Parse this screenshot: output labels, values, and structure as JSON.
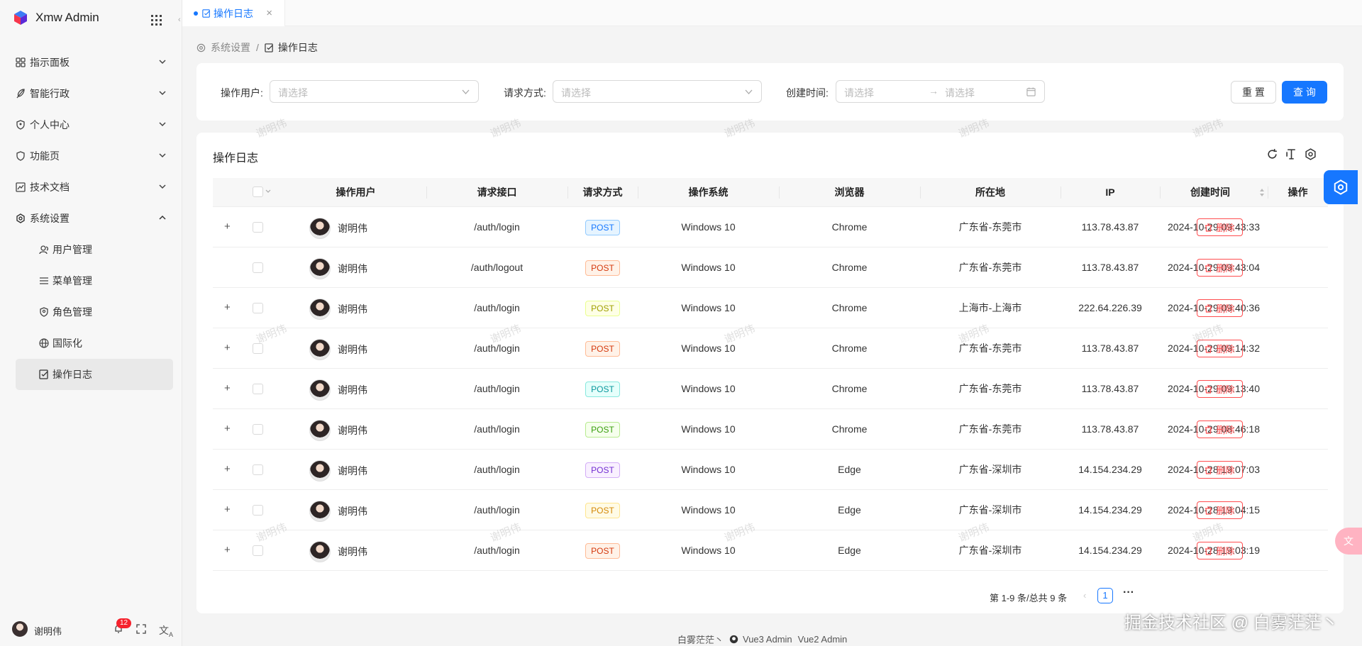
{
  "app": {
    "title": "Xmw Admin"
  },
  "sidebar": {
    "menu": [
      {
        "label": "指示面板",
        "icon": "dashboard-icon"
      },
      {
        "label": "智能行政",
        "icon": "feather-icon"
      },
      {
        "label": "个人中心",
        "icon": "user-shield-icon"
      },
      {
        "label": "功能页",
        "icon": "feature-icon"
      },
      {
        "label": "技术文档",
        "icon": "chart-doc-icon"
      },
      {
        "label": "系统设置",
        "icon": "settings-icon",
        "expanded": true
      }
    ],
    "submenu": [
      {
        "label": "用户管理",
        "icon": "users-icon"
      },
      {
        "label": "菜单管理",
        "icon": "menu-lines-icon"
      },
      {
        "label": "角色管理",
        "icon": "role-icon"
      },
      {
        "label": "国际化",
        "icon": "globe-icon"
      },
      {
        "label": "操作日志",
        "icon": "log-icon",
        "active": true
      }
    ],
    "user": {
      "name": "谢明伟",
      "notifications": "12"
    }
  },
  "tabs": [
    {
      "label": "操作日志"
    }
  ],
  "breadcrumb": {
    "parent": "系统设置",
    "current": "操作日志"
  },
  "search": {
    "user_label": "操作用户:",
    "user_placeholder": "请选择",
    "method_label": "请求方式:",
    "method_placeholder": "请选择",
    "time_label": "创建时间:",
    "time_start_placeholder": "请选择",
    "time_end_placeholder": "请选择",
    "reset_label": "重 置",
    "query_label": "查 询"
  },
  "table": {
    "title": "操作日志",
    "columns": [
      "操作用户",
      "请求接口",
      "请求方式",
      "操作系统",
      "浏览器",
      "所在地",
      "IP",
      "创建时间",
      "操作"
    ],
    "delete_label": "删除",
    "rows": [
      {
        "expand": "+",
        "user": "谢明伟",
        "api": "/auth/login",
        "method": "POST",
        "tag_color": "#1677ff",
        "tag_bg": "#e6f4ff",
        "tag_border": "#91caff",
        "os": "Windows 10",
        "browser": "Chrome",
        "location": "广东省-东莞市",
        "ip": "113.78.43.87",
        "time": "2024-10-29 09:43:33"
      },
      {
        "expand": "",
        "user": "谢明伟",
        "api": "/auth/logout",
        "method": "POST",
        "tag_color": "#d4380d",
        "tag_bg": "#fff2e8",
        "tag_border": "#ffbb96",
        "os": "Windows 10",
        "browser": "Chrome",
        "location": "广东省-东莞市",
        "ip": "113.78.43.87",
        "time": "2024-10-29 09:43:04"
      },
      {
        "expand": "+",
        "user": "谢明伟",
        "api": "/auth/login",
        "method": "POST",
        "tag_color": "#a0a000",
        "tag_bg": "#feffe6",
        "tag_border": "#eaff8f",
        "os": "Windows 10",
        "browser": "Chrome",
        "location": "上海市-上海市",
        "ip": "222.64.226.39",
        "time": "2024-10-29 09:40:36"
      },
      {
        "expand": "+",
        "user": "谢明伟",
        "api": "/auth/login",
        "method": "POST",
        "tag_color": "#d4380d",
        "tag_bg": "#fff2e8",
        "tag_border": "#ffbb96",
        "os": "Windows 10",
        "browser": "Chrome",
        "location": "广东省-东莞市",
        "ip": "113.78.43.87",
        "time": "2024-10-29 09:14:32"
      },
      {
        "expand": "+",
        "user": "谢明伟",
        "api": "/auth/login",
        "method": "POST",
        "tag_color": "#08979c",
        "tag_bg": "#e6fffb",
        "tag_border": "#87e8de",
        "os": "Windows 10",
        "browser": "Chrome",
        "location": "广东省-东莞市",
        "ip": "113.78.43.87",
        "time": "2024-10-29 09:13:40"
      },
      {
        "expand": "+",
        "user": "谢明伟",
        "api": "/auth/login",
        "method": "POST",
        "tag_color": "#389e0d",
        "tag_bg": "#f6ffed",
        "tag_border": "#b7eb8f",
        "os": "Windows 10",
        "browser": "Chrome",
        "location": "广东省-东莞市",
        "ip": "113.78.43.87",
        "time": "2024-10-29 08:46:18"
      },
      {
        "expand": "+",
        "user": "谢明伟",
        "api": "/auth/login",
        "method": "POST",
        "tag_color": "#722ed1",
        "tag_bg": "#f9f0ff",
        "tag_border": "#d3adf7",
        "os": "Windows 10",
        "browser": "Edge",
        "location": "广东省-深圳市",
        "ip": "14.154.234.29",
        "time": "2024-10-28 19:07:03"
      },
      {
        "expand": "+",
        "user": "谢明伟",
        "api": "/auth/login",
        "method": "POST",
        "tag_color": "#d48806",
        "tag_bg": "#fffbe6",
        "tag_border": "#ffe58f",
        "os": "Windows 10",
        "browser": "Edge",
        "location": "广东省-深圳市",
        "ip": "14.154.234.29",
        "time": "2024-10-28 19:04:15"
      },
      {
        "expand": "+",
        "user": "谢明伟",
        "api": "/auth/login",
        "method": "POST",
        "tag_color": "#d4380d",
        "tag_bg": "#fff2e8",
        "tag_border": "#ffbb96",
        "os": "Windows 10",
        "browser": "Edge",
        "location": "广东省-深圳市",
        "ip": "14.154.234.29",
        "time": "2024-10-28 19:03:19"
      }
    ]
  },
  "pagination": {
    "summary": "第 1-9 条/总共 9 条",
    "page": "1"
  },
  "footer": {
    "author": "白雾茫茫丶",
    "link1": "Vue3 Admin",
    "link2": "Vue2 Admin"
  },
  "watermark": "谢明伟",
  "overlay_text": "掘金技术社区 @ 白雾茫茫丶",
  "colors": {
    "primary": "#1677ff",
    "danger": "#ff4d4f"
  }
}
